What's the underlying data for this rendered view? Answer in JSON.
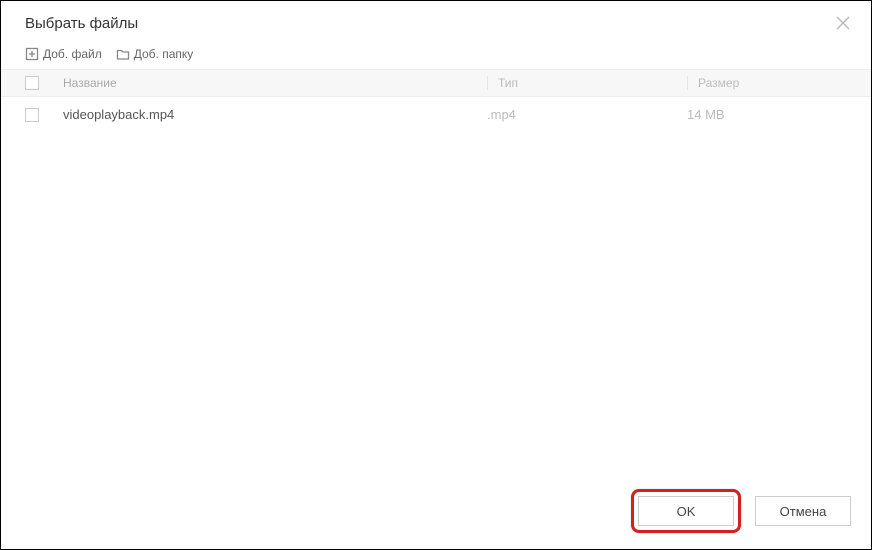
{
  "title": "Выбрать файлы",
  "toolbar": {
    "add_file_label": "Доб. файл",
    "add_folder_label": "Доб. папку"
  },
  "columns": {
    "name": "Название",
    "type": "Тип",
    "size": "Размер"
  },
  "rows": [
    {
      "name": "videoplayback.mp4",
      "type": ".mp4",
      "size": "14 MB"
    }
  ],
  "buttons": {
    "ok": "OK",
    "cancel": "Отмена"
  }
}
